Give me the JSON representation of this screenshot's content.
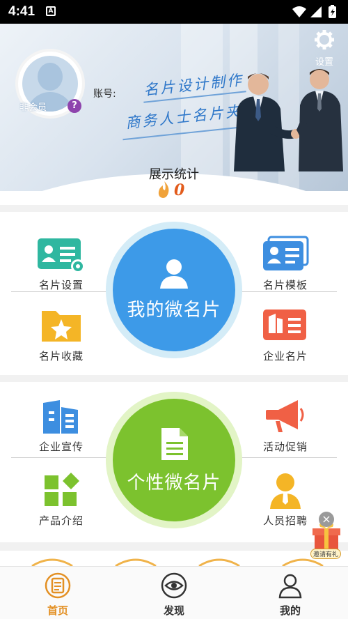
{
  "status_bar": {
    "time": "4:41",
    "notification_icon": "A"
  },
  "header": {
    "avatar_label": "非会员",
    "member_badge": "?",
    "account_label": "账号:",
    "slogan_1": "名片设计制作",
    "slogan_2": "商务人士名片夹",
    "settings_label": "设置"
  },
  "stats": {
    "title": "展示统计",
    "value": "0"
  },
  "section1": {
    "center_label": "我的微名片",
    "tiles": {
      "card_settings": "名片设置",
      "card_templates": "名片模板",
      "card_favorites": "名片收藏",
      "company_card": "企业名片"
    },
    "colors": {
      "center": "#3d9ae8",
      "halo": "#d4ecf7"
    }
  },
  "section2": {
    "center_label": "个性微名片",
    "tiles": {
      "company_promo": "企业宣传",
      "event_promo": "活动促销",
      "product_intro": "产品介绍",
      "recruitment": "人员招聘"
    },
    "colors": {
      "center": "#7cc22e",
      "halo": "#e2f4c6"
    }
  },
  "gift": {
    "label": "邀请有礼",
    "close": "×"
  },
  "tabbar": {
    "tabs": [
      {
        "label": "首页",
        "icon": "home-icon",
        "active": true
      },
      {
        "label": "发现",
        "icon": "eye-icon",
        "active": false
      },
      {
        "label": "我的",
        "icon": "user-icon",
        "active": false
      }
    ],
    "colors": {
      "active": "#e39024",
      "inactive": "#333333"
    }
  }
}
